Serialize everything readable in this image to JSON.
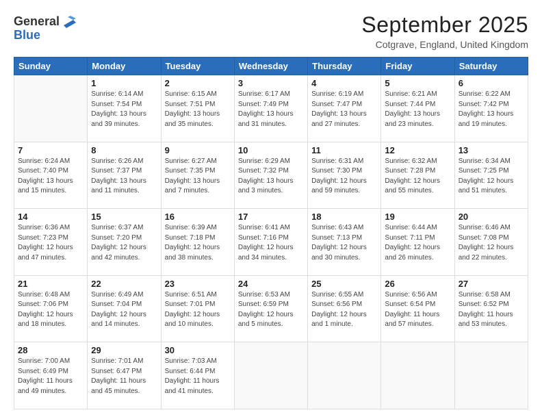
{
  "header": {
    "logo_line1": "General",
    "logo_line2": "Blue",
    "month": "September 2025",
    "location": "Cotgrave, England, United Kingdom"
  },
  "days_of_week": [
    "Sunday",
    "Monday",
    "Tuesday",
    "Wednesday",
    "Thursday",
    "Friday",
    "Saturday"
  ],
  "weeks": [
    [
      {
        "day": "",
        "info": ""
      },
      {
        "day": "1",
        "info": "Sunrise: 6:14 AM\nSunset: 7:54 PM\nDaylight: 13 hours\nand 39 minutes."
      },
      {
        "day": "2",
        "info": "Sunrise: 6:15 AM\nSunset: 7:51 PM\nDaylight: 13 hours\nand 35 minutes."
      },
      {
        "day": "3",
        "info": "Sunrise: 6:17 AM\nSunset: 7:49 PM\nDaylight: 13 hours\nand 31 minutes."
      },
      {
        "day": "4",
        "info": "Sunrise: 6:19 AM\nSunset: 7:47 PM\nDaylight: 13 hours\nand 27 minutes."
      },
      {
        "day": "5",
        "info": "Sunrise: 6:21 AM\nSunset: 7:44 PM\nDaylight: 13 hours\nand 23 minutes."
      },
      {
        "day": "6",
        "info": "Sunrise: 6:22 AM\nSunset: 7:42 PM\nDaylight: 13 hours\nand 19 minutes."
      }
    ],
    [
      {
        "day": "7",
        "info": "Sunrise: 6:24 AM\nSunset: 7:40 PM\nDaylight: 13 hours\nand 15 minutes."
      },
      {
        "day": "8",
        "info": "Sunrise: 6:26 AM\nSunset: 7:37 PM\nDaylight: 13 hours\nand 11 minutes."
      },
      {
        "day": "9",
        "info": "Sunrise: 6:27 AM\nSunset: 7:35 PM\nDaylight: 13 hours\nand 7 minutes."
      },
      {
        "day": "10",
        "info": "Sunrise: 6:29 AM\nSunset: 7:32 PM\nDaylight: 13 hours\nand 3 minutes."
      },
      {
        "day": "11",
        "info": "Sunrise: 6:31 AM\nSunset: 7:30 PM\nDaylight: 12 hours\nand 59 minutes."
      },
      {
        "day": "12",
        "info": "Sunrise: 6:32 AM\nSunset: 7:28 PM\nDaylight: 12 hours\nand 55 minutes."
      },
      {
        "day": "13",
        "info": "Sunrise: 6:34 AM\nSunset: 7:25 PM\nDaylight: 12 hours\nand 51 minutes."
      }
    ],
    [
      {
        "day": "14",
        "info": "Sunrise: 6:36 AM\nSunset: 7:23 PM\nDaylight: 12 hours\nand 47 minutes."
      },
      {
        "day": "15",
        "info": "Sunrise: 6:37 AM\nSunset: 7:20 PM\nDaylight: 12 hours\nand 42 minutes."
      },
      {
        "day": "16",
        "info": "Sunrise: 6:39 AM\nSunset: 7:18 PM\nDaylight: 12 hours\nand 38 minutes."
      },
      {
        "day": "17",
        "info": "Sunrise: 6:41 AM\nSunset: 7:16 PM\nDaylight: 12 hours\nand 34 minutes."
      },
      {
        "day": "18",
        "info": "Sunrise: 6:43 AM\nSunset: 7:13 PM\nDaylight: 12 hours\nand 30 minutes."
      },
      {
        "day": "19",
        "info": "Sunrise: 6:44 AM\nSunset: 7:11 PM\nDaylight: 12 hours\nand 26 minutes."
      },
      {
        "day": "20",
        "info": "Sunrise: 6:46 AM\nSunset: 7:08 PM\nDaylight: 12 hours\nand 22 minutes."
      }
    ],
    [
      {
        "day": "21",
        "info": "Sunrise: 6:48 AM\nSunset: 7:06 PM\nDaylight: 12 hours\nand 18 minutes."
      },
      {
        "day": "22",
        "info": "Sunrise: 6:49 AM\nSunset: 7:04 PM\nDaylight: 12 hours\nand 14 minutes."
      },
      {
        "day": "23",
        "info": "Sunrise: 6:51 AM\nSunset: 7:01 PM\nDaylight: 12 hours\nand 10 minutes."
      },
      {
        "day": "24",
        "info": "Sunrise: 6:53 AM\nSunset: 6:59 PM\nDaylight: 12 hours\nand 5 minutes."
      },
      {
        "day": "25",
        "info": "Sunrise: 6:55 AM\nSunset: 6:56 PM\nDaylight: 12 hours\nand 1 minute."
      },
      {
        "day": "26",
        "info": "Sunrise: 6:56 AM\nSunset: 6:54 PM\nDaylight: 11 hours\nand 57 minutes."
      },
      {
        "day": "27",
        "info": "Sunrise: 6:58 AM\nSunset: 6:52 PM\nDaylight: 11 hours\nand 53 minutes."
      }
    ],
    [
      {
        "day": "28",
        "info": "Sunrise: 7:00 AM\nSunset: 6:49 PM\nDaylight: 11 hours\nand 49 minutes."
      },
      {
        "day": "29",
        "info": "Sunrise: 7:01 AM\nSunset: 6:47 PM\nDaylight: 11 hours\nand 45 minutes."
      },
      {
        "day": "30",
        "info": "Sunrise: 7:03 AM\nSunset: 6:44 PM\nDaylight: 11 hours\nand 41 minutes."
      },
      {
        "day": "",
        "info": ""
      },
      {
        "day": "",
        "info": ""
      },
      {
        "day": "",
        "info": ""
      },
      {
        "day": "",
        "info": ""
      }
    ]
  ]
}
